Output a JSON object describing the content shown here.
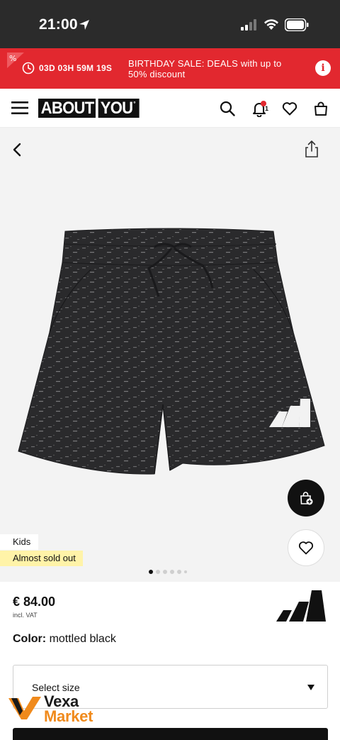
{
  "status_bar": {
    "time": "21:00"
  },
  "sale_banner": {
    "countdown": "03D 03H 59M 19S",
    "text": "BIRTHDAY SALE: DEALS with up to 50% discount",
    "info_icon": "info-icon",
    "color": "#e2282f"
  },
  "header": {
    "logo_left": "ABOUT",
    "logo_right": "YOU",
    "logo_mark": "°",
    "notification_count": "1",
    "icons": [
      "menu-icon",
      "search-icon",
      "bell-icon",
      "heart-icon",
      "bag-icon"
    ]
  },
  "gallery": {
    "image_count": 6,
    "active_index": 0,
    "tags": {
      "category": "Kids",
      "stock": "Almost sold out"
    }
  },
  "product": {
    "price": "€ 84.00",
    "vat_note": "incl. VAT",
    "color_label": "Color:",
    "color_value": "mottled black"
  },
  "size_select": {
    "placeholder": "Select size"
  },
  "watermark": {
    "line1": "Vexa",
    "line2": "Market"
  }
}
